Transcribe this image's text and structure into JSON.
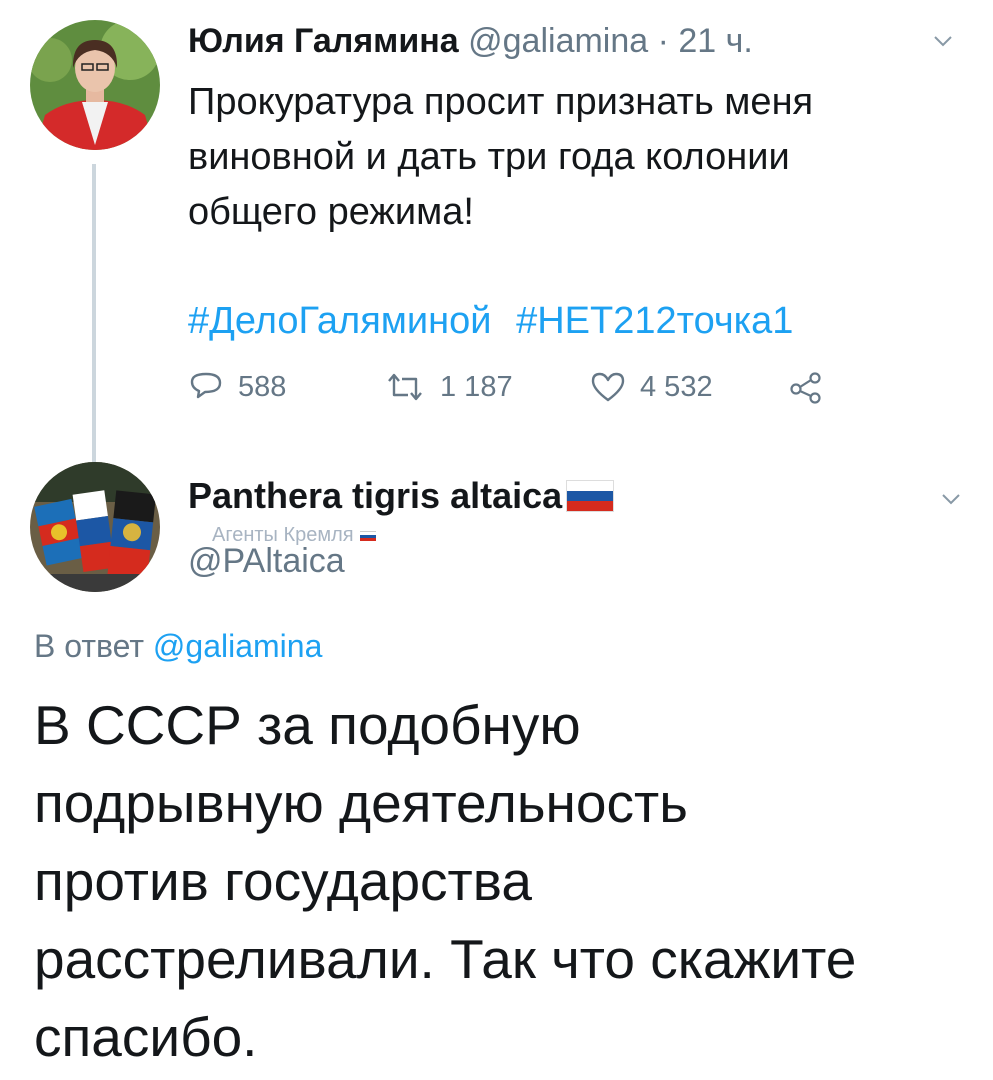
{
  "tweet1": {
    "author_name": "Юлия Галямина",
    "handle": "@galiamina",
    "separator": " · ",
    "time": "21 ч.",
    "text": "Прокуратура просит признать меня\nвиновной и дать три года колонии\nобщего режима!",
    "hashtags": [
      "#ДелоГаляминой",
      "#НЕТ212точка1"
    ],
    "actions": {
      "replies": "588",
      "retweets": "1 187",
      "likes": "4 532"
    },
    "avatar_icon": "user-photo-avatar",
    "menu_icon": "chevron-down-icon"
  },
  "tweet2": {
    "author_name": "Panthera tigris altaica",
    "annotation": "Агенты Кремля",
    "handle": "@PAltaica",
    "reply_prefix": "В ответ ",
    "reply_mention": "@galiamina",
    "text": "В СССР за подобную\nподрывную деятельность\nпротив государства\nрасстреливали. Так что скажите\nспасибо.",
    "avatar_icon": "flags-avatar",
    "menu_icon": "chevron-down-icon"
  },
  "colors": {
    "accent": "#1da1f2",
    "secondary_text": "#657786",
    "primary_text": "#14171a",
    "thread_line": "#ccd6dd",
    "flag_white": "#ffffff",
    "flag_blue": "#1c57a5",
    "flag_red": "#d52b1e"
  }
}
